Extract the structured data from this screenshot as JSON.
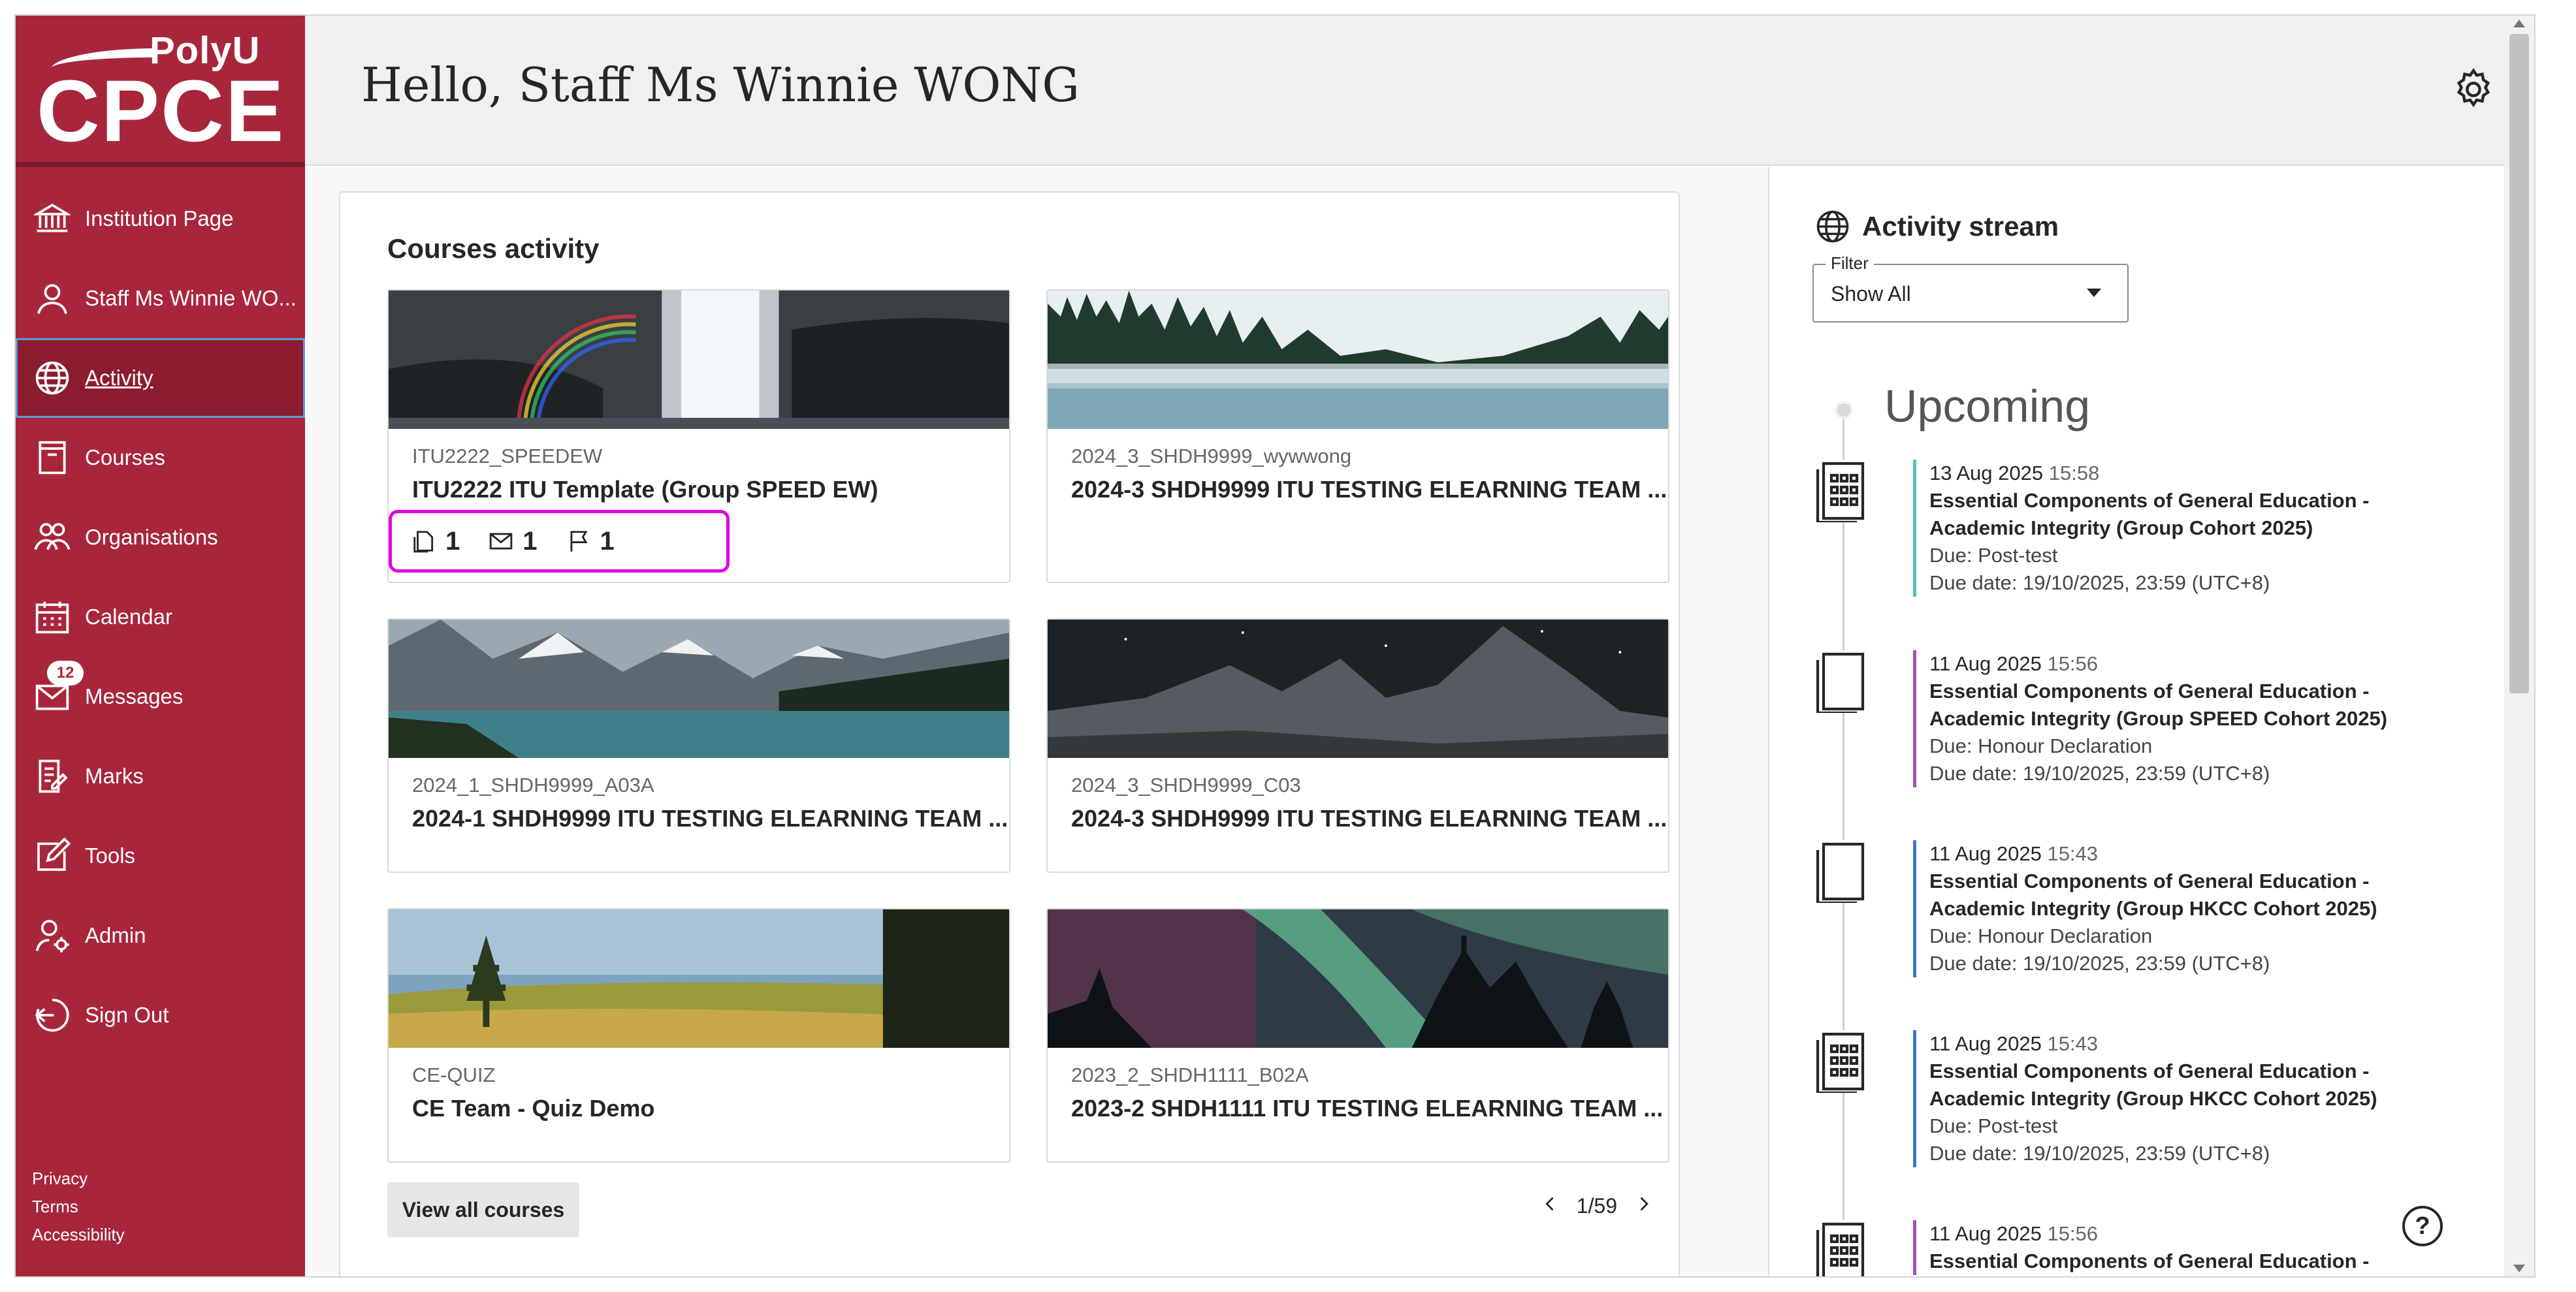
{
  "brand": {
    "logo_top": "PolyU",
    "logo_main": "CPCE"
  },
  "sidebar": {
    "items": [
      {
        "label": "Institution Page",
        "icon": "institution-icon"
      },
      {
        "label": "Staff Ms Winnie WO...",
        "icon": "user-icon"
      },
      {
        "label": "Activity",
        "icon": "globe-icon",
        "active": true
      },
      {
        "label": "Courses",
        "icon": "book-icon"
      },
      {
        "label": "Organisations",
        "icon": "people-icon"
      },
      {
        "label": "Calendar",
        "icon": "calendar-icon"
      },
      {
        "label": "Messages",
        "icon": "envelope-icon",
        "badge": "12"
      },
      {
        "label": "Marks",
        "icon": "marks-icon"
      },
      {
        "label": "Tools",
        "icon": "edit-icon"
      },
      {
        "label": "Admin",
        "icon": "admin-icon"
      },
      {
        "label": "Sign Out",
        "icon": "sign-out-icon"
      }
    ],
    "footer": [
      "Privacy",
      "Terms",
      "Accessibility"
    ]
  },
  "header": {
    "greeting": "Hello, Staff Ms Winnie WONG"
  },
  "courses": {
    "title": "Courses activity",
    "cards": [
      {
        "code": "ITU2222_SPEEDEW",
        "name": "ITU2222 ITU Template (Group SPEED EW)",
        "stats": {
          "assignments": "1",
          "messages": "1",
          "flags": "1"
        }
      },
      {
        "code": "2024_3_SHDH9999_wywwong",
        "name": "2024-3 SHDH9999 ITU TESTING ELEARNING TEAM ..."
      },
      {
        "code": "2024_1_SHDH9999_A03A",
        "name": "2024-1 SHDH9999 ITU TESTING ELEARNING TEAM ..."
      },
      {
        "code": "2024_3_SHDH9999_C03",
        "name": "2024-3 SHDH9999 ITU TESTING ELEARNING TEAM ..."
      },
      {
        "code": "CE-QUIZ",
        "name": "CE Team - Quiz Demo"
      },
      {
        "code": "2023_2_SHDH1111_B02A",
        "name": "2023-2 SHDH1111 ITU TESTING ELEARNING TEAM ..."
      }
    ],
    "view_all": "View all courses",
    "pager": "1/59"
  },
  "stream": {
    "title": "Activity stream",
    "filter_label": "Filter",
    "filter_value": "Show All",
    "section": "Upcoming",
    "events": [
      {
        "date": "13 Aug 2025",
        "time": "15:58",
        "title_1": "Essential Components of General Education -",
        "title_2": "Academic Integrity (Group Cohort 2025)",
        "due": "Due: Post-test",
        "due_date": "Due date: 19/10/2025, 23:59 (UTC+8)",
        "icon": "test-icon",
        "accent": "#50c5b7"
      },
      {
        "date": "11 Aug 2025",
        "time": "15:56",
        "title_1": "Essential Components of General Education -",
        "title_2": "Academic Integrity (Group SPEED Cohort 2025)",
        "due": "Due: Honour Declaration",
        "due_date": "Due date: 19/10/2025, 23:59 (UTC+8)",
        "icon": "assignment-icon",
        "accent": "#a94cb8"
      },
      {
        "date": "11 Aug 2025",
        "time": "15:43",
        "title_1": "Essential Components of General Education -",
        "title_2": "Academic Integrity (Group HKCC Cohort 2025)",
        "due": "Due: Honour Declaration",
        "due_date": "Due date: 19/10/2025, 23:59 (UTC+8)",
        "icon": "assignment-icon",
        "accent": "#3b78d8"
      },
      {
        "date": "11 Aug 2025",
        "time": "15:43",
        "title_1": "Essential Components of General Education -",
        "title_2": "Academic Integrity (Group HKCC Cohort 2025)",
        "due": "Due: Post-test",
        "due_date": "Due date: 19/10/2025, 23:59 (UTC+8)",
        "icon": "test-icon",
        "accent": "#3b78d8"
      },
      {
        "date": "11 Aug 2025",
        "time": "15:56",
        "title_1": "Essential Components of General Education -",
        "title_2": "",
        "due": "",
        "due_date": "",
        "icon": "test-icon",
        "accent": "#a94cb8"
      }
    ]
  },
  "colors": {
    "brand": "#a8263b",
    "highlight": "#e000e0"
  }
}
